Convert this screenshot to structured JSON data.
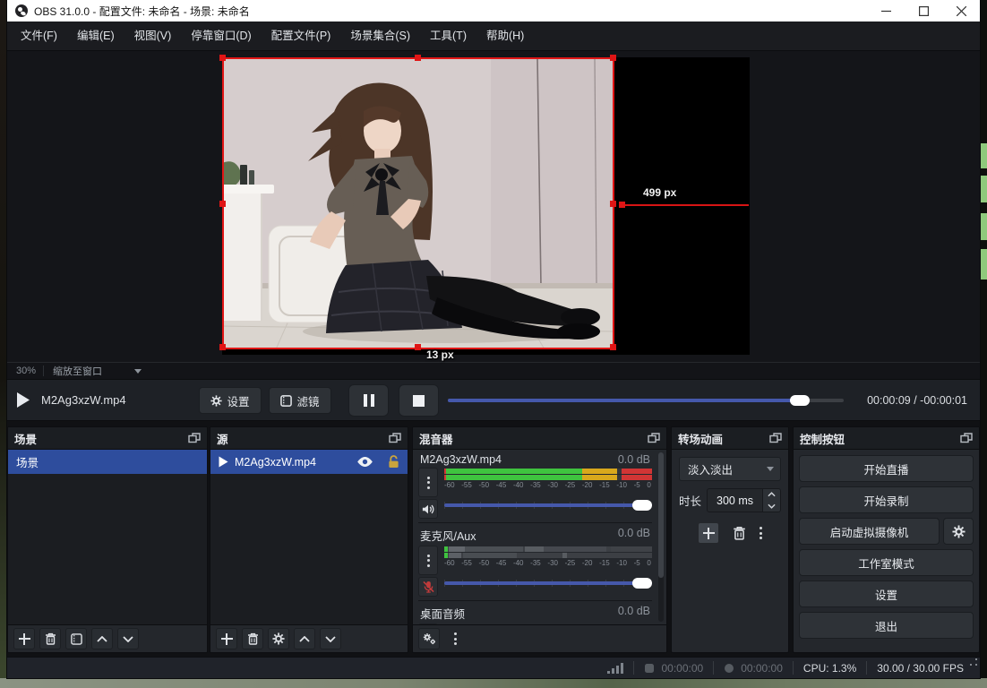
{
  "window": {
    "title": "OBS 31.0.0 - 配置文件: 未命名 - 场景: 未命名"
  },
  "menu": {
    "items": [
      {
        "label": "文件(F)"
      },
      {
        "label": "编辑(E)"
      },
      {
        "label": "视图(V)"
      },
      {
        "label": "停靠窗口(D)"
      },
      {
        "label": "配置文件(P)"
      },
      {
        "label": "场景集合(S)"
      },
      {
        "label": "工具(T)"
      },
      {
        "label": "帮助(H)"
      }
    ]
  },
  "preview": {
    "zoom_percent": "30%",
    "zoom_mode": "缩放至窗口",
    "width_measure": "499 px",
    "height_measure": "13 px"
  },
  "media": {
    "filename": "M2Ag3xzW.mp4",
    "settings_label": "设置",
    "filters_label": "滤镜",
    "time": "00:00:09  /  -00:00:01",
    "progress_pct": 89
  },
  "scenes": {
    "title": "场景",
    "items": [
      {
        "label": "场景",
        "selected": true
      }
    ]
  },
  "sources": {
    "title": "源",
    "items": [
      {
        "label": "M2Ag3xzW.mp4",
        "selected": true,
        "visible": true,
        "locked": false
      }
    ]
  },
  "mixer": {
    "title": "混音器",
    "ticks": [
      "-60",
      "-55",
      "-50",
      "-45",
      "-40",
      "-35",
      "-30",
      "-25",
      "-20",
      "-15",
      "-10",
      "-5",
      "0"
    ],
    "channels": [
      {
        "name": "M2Ag3xzW.mp4",
        "db": "0.0 dB",
        "muted": false
      },
      {
        "name": "麦克风/Aux",
        "db": "0.0 dB",
        "muted": true
      },
      {
        "name": "桌面音频",
        "db": "0.0 dB",
        "muted": false
      }
    ]
  },
  "transitions": {
    "title": "转场动画",
    "selected": "淡入淡出",
    "duration_label": "时长",
    "duration_value": "300 ms"
  },
  "controls": {
    "title": "控制按钮",
    "stream": "开始直播",
    "record": "开始录制",
    "virtualcam": "启动虚拟摄像机",
    "studio_mode": "工作室模式",
    "settings": "设置",
    "exit": "退出"
  },
  "statusbar": {
    "stream_time": "00:00:00",
    "rec_time": "00:00:00",
    "cpu": "CPU: 1.3%",
    "fps": "30.00 / 30.00 FPS"
  },
  "colors": {
    "selection_red": "#e01515",
    "accent_blue": "#2e4d9d",
    "slider_blue": "#4558ab",
    "meter_green": "#3fc33f",
    "meter_yellow": "#d9a81c",
    "meter_red": "#d13535",
    "lock_gold": "#c9a43d"
  }
}
